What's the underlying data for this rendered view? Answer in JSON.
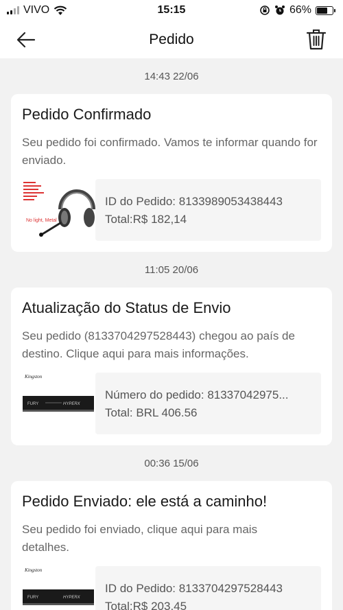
{
  "status_bar": {
    "carrier": "VIVO",
    "time": "15:15",
    "battery": "66%",
    "battery_level": 0.66
  },
  "header": {
    "title": "Pedido"
  },
  "notifications": [
    {
      "timestamp": "14:43 22/06",
      "title": "Pedido Confirmado",
      "text": "Seu pedido foi confirmado. Vamos te informar quando for enviado.",
      "thumbnail": "headset-product-image",
      "line1": "ID do Pedido: 8133989053438443",
      "line2": "Total:R$ 182,14"
    },
    {
      "timestamp": "11:05 20/06",
      "title": "Atualização do Status de Envio",
      "text": "Seu pedido (8133704297528443) chegou ao país de destino. Clique aqui para mais informações.",
      "thumbnail": "ram-memory-product-image",
      "line1": "Número do pedido: 81337042975...",
      "line2": "Total: BRL 406.56"
    },
    {
      "timestamp": "00:36 15/06",
      "title": "Pedido Enviado: ele está a caminho!",
      "text": "Seu pedido foi enviado, clique aqui para mais detalhes.",
      "thumbnail": "ram-memory-product-image",
      "line1": "ID do Pedido: 8133704297528443",
      "line2": "Total:R$ 203,45"
    }
  ],
  "thumb_labels": {
    "headset_caption": "No light, Metal",
    "ram_brand": "Kingston",
    "ram_text_left": "FURY",
    "ram_text_right": "HYPERX"
  }
}
